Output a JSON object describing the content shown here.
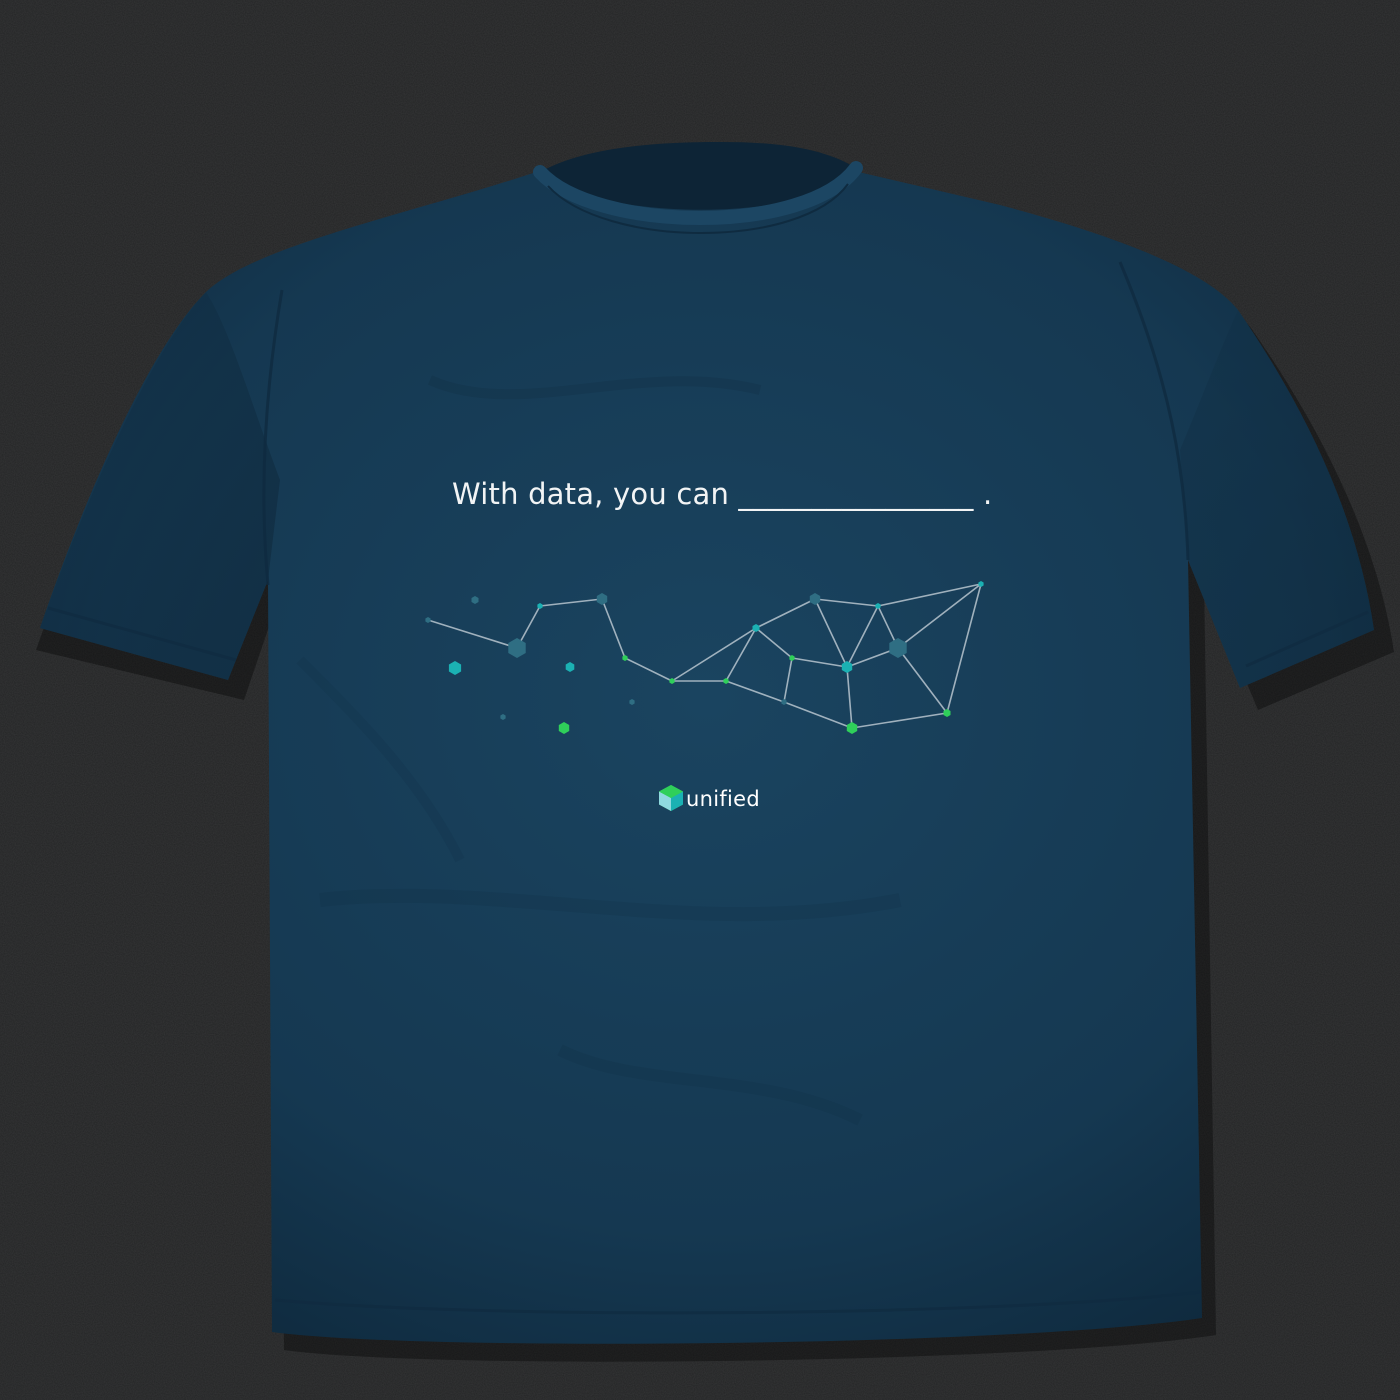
{
  "shirt": {
    "tagline": "With data, you can ________________ .",
    "brand_name": "unified",
    "logo": "unified-cube-logo"
  },
  "colors": {
    "background": "#232425",
    "shirt": "#163952",
    "text": "#f2f4f5",
    "network_line": "#b9c6cf",
    "node_teal": "#1bb1b3",
    "node_green": "#2fcf5a",
    "node_dark_teal": "#2f6e83"
  },
  "graphic": {
    "type": "network-constellation",
    "icons": [
      "hexagon-node"
    ]
  }
}
